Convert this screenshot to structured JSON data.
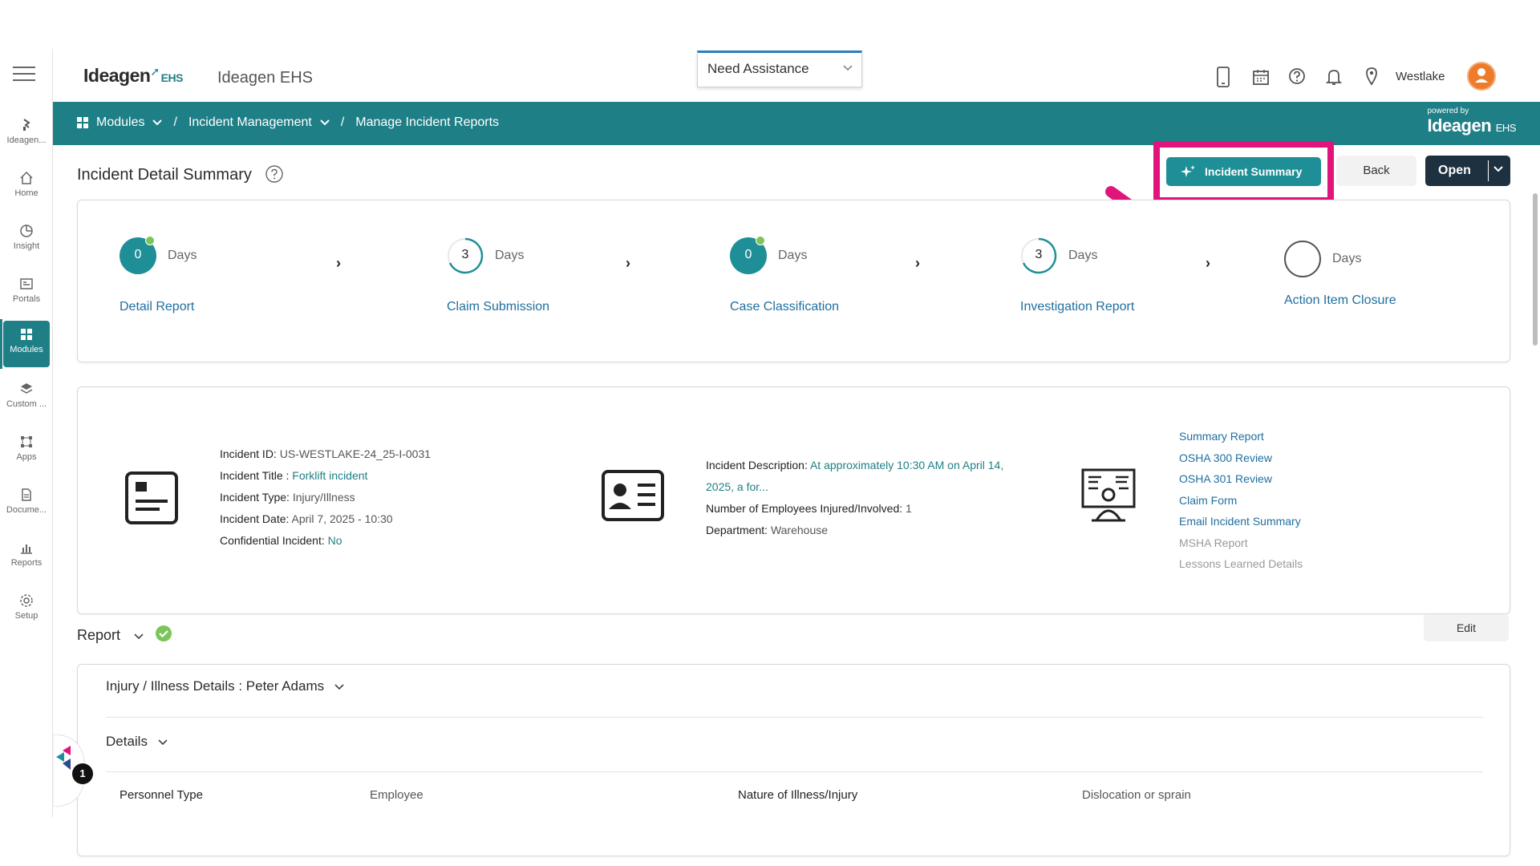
{
  "header": {
    "logo_text": "Ideagen",
    "logo_suffix": "EHS",
    "app_title": "Ideagen EHS",
    "assist_label": "Need Assistance",
    "location_label": "Westlake"
  },
  "sidebar": {
    "items": [
      {
        "label": "Ideagen...",
        "icon": "ideagen-icon"
      },
      {
        "label": "Home",
        "icon": "home-icon"
      },
      {
        "label": "Insight",
        "icon": "insight-icon"
      },
      {
        "label": "Portals",
        "icon": "portals-icon"
      },
      {
        "label": "Modules",
        "icon": "modules-icon"
      },
      {
        "label": "Custom ...",
        "icon": "custom-icon"
      },
      {
        "label": "Apps",
        "icon": "apps-icon"
      },
      {
        "label": "Docume...",
        "icon": "documents-icon"
      },
      {
        "label": "Reports",
        "icon": "reports-icon"
      },
      {
        "label": "Setup",
        "icon": "setup-icon"
      }
    ]
  },
  "breadcrumb": {
    "modules": "Modules",
    "incident_management": "Incident Management",
    "current": "Manage Incident Reports",
    "sep": "/",
    "powered_by": "powered by",
    "powered_logo": "Ideagen",
    "powered_suffix": "EHS"
  },
  "page": {
    "title": "Incident Detail Summary",
    "incident_summary_button": "Incident Summary",
    "back_button": "Back",
    "open_button": "Open"
  },
  "stages": [
    {
      "count": "0",
      "unit": "Days",
      "name": "Detail Report",
      "done": true
    },
    {
      "count": "3",
      "unit": "Days",
      "name": "Claim Submission",
      "done": false
    },
    {
      "count": "0",
      "unit": "Days",
      "name": "Case Classification",
      "done": true
    },
    {
      "count": "3",
      "unit": "Days",
      "name": "Investigation Report",
      "done": false
    },
    {
      "count": "",
      "unit": "Days",
      "name": "Action Item Closure",
      "done": false
    }
  ],
  "incident": {
    "id_label": "Incident ID:",
    "id_value": "US-WESTLAKE-24_25-I-0031",
    "title_label": "Incident Title :",
    "title_value": "Forklift incident",
    "type_label": "Incident Type:",
    "type_value": "Injury/Illness",
    "date_label": "Incident Date:",
    "date_value": "April 7, 2025 - 10:30",
    "confidential_label": "Confidential Incident:",
    "confidential_value": "No",
    "desc_label": "Incident Description:",
    "desc_value_1": "At approximately 10:30 AM on April 14,",
    "desc_value_2": "2025, a for...",
    "employees_label": "Number of Employees Injured/Involved:",
    "employees_value": "1",
    "dept_label": "Department:",
    "dept_value": "Warehouse"
  },
  "links": [
    {
      "label": "Summary Report",
      "enabled": true
    },
    {
      "label": "OSHA 300 Review",
      "enabled": true
    },
    {
      "label": "OSHA 301 Review",
      "enabled": true
    },
    {
      "label": "Claim Form",
      "enabled": true
    },
    {
      "label": "Email Incident Summary",
      "enabled": true
    },
    {
      "label": "MSHA Report",
      "enabled": false
    },
    {
      "label": "Lessons Learned Details",
      "enabled": false
    }
  ],
  "report": {
    "title": "Report",
    "edit_button": "Edit",
    "injury_section": "Injury / Illness Details : Peter Adams",
    "details_section": "Details",
    "personnel_type_label": "Personnel Type",
    "personnel_type_value": "Employee",
    "nature_label": "Nature of Illness/Injury",
    "nature_value": "Dislocation or sprain"
  },
  "chat": {
    "badge_count": "1"
  },
  "colors": {
    "teal": "#1f7f86",
    "highlight": "#e0147a",
    "link": "#1f6f9f",
    "dark_button": "#1e3140"
  }
}
